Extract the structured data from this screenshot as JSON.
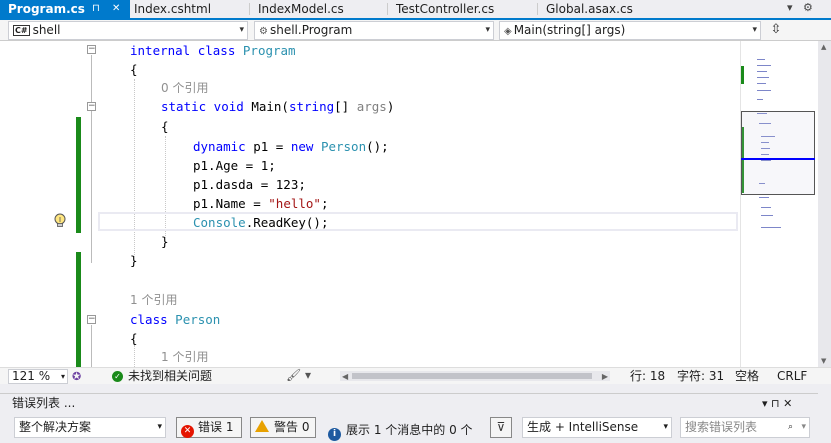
{
  "tabs": [
    {
      "label": "Program.cs",
      "active": true
    },
    {
      "label": "Index.cshtml"
    },
    {
      "label": "IndexModel.cs"
    },
    {
      "label": "TestController.cs"
    },
    {
      "label": "Global.asax.cs"
    }
  ],
  "tab_controls": {
    "pin": "⊓",
    "close": "✕"
  },
  "strip_right": {
    "dropdown": "▾",
    "settings": "⚙"
  },
  "nav": {
    "project": "shell",
    "project_badge": "C#",
    "class": "shell.Program",
    "member": "Main(string[] args)",
    "arrow": "▾",
    "split": "⇳"
  },
  "code": {
    "l1_kw": "internal class",
    "l1_type": "Program",
    "l2": "{",
    "l3_ref": "0 个引用",
    "l4_kw": "static void",
    "l4_name": "Main(",
    "l4_kw2": "string",
    "l4_rest": "[]",
    "l4_param": "args",
    "l4_close": ")",
    "l5": "{",
    "l6_kw": "dynamic",
    "l6_mid": " p1 = ",
    "l6_kw2": "new",
    "l6_type": "Person",
    "l6_end": "();",
    "l7": "p1.Age = 1;",
    "l8": "p1.dasda = 123;",
    "l9_pre": "p1.Name = ",
    "l9_str": "\"hello\"",
    "l9_end": ";",
    "l10_type": "Console",
    "l10_end": ".ReadKey();",
    "l11": "}",
    "l12": "}",
    "l13_ref": "1 个引用",
    "l14_kw": "class",
    "l14_type": "Person",
    "l15": "{",
    "l16_ref": "1 个引用"
  },
  "status": {
    "zoom": "121 %",
    "issues": "未找到相关问题",
    "line": "行: 18",
    "col": "字符: 31",
    "ws": "空格",
    "eol": "CRLF"
  },
  "errorlist": {
    "title": "错误列表 ...",
    "scope": "整个解决方案",
    "errors": "错误 1",
    "warnings": "警告 0",
    "messages": "展示 1 个消息中的 0 个",
    "source": "生成 + IntelliSense",
    "search_placeholder": "搜索错误列表",
    "title_controls": "▾ ⊓ ✕"
  },
  "colors": {
    "accent": "#007acc",
    "change_bar": "#1a8a1a",
    "keyword": "#0000ff",
    "type": "#2b91af",
    "string": "#a31515"
  }
}
